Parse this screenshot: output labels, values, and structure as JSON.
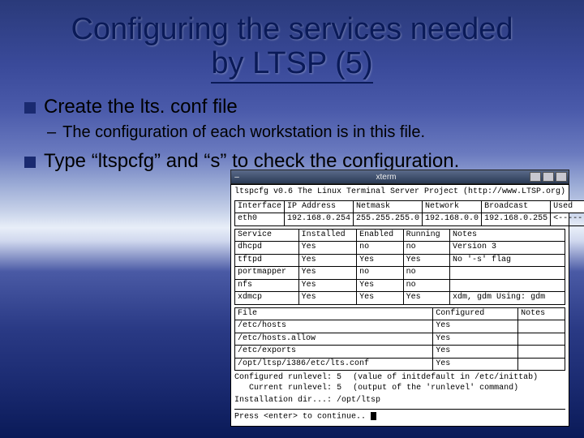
{
  "title_line1": "Configuring the services needed",
  "title_line2": "by LTSP (5)",
  "bullets": {
    "b1": "Create the lts. conf file",
    "b1a": "The configuration of each workstation is in this file.",
    "b2": "Type “ltspcfg” and “s” to check the configuration."
  },
  "terminal": {
    "window_title": "xterm",
    "header_left": "ltspcfg v0.6",
    "header_right": "The Linux Terminal Server Project (http://www.LTSP.org)",
    "iface": {
      "cols": [
        "Interface",
        "IP Address",
        "Netmask",
        "Network",
        "Broadcast",
        "Used"
      ],
      "row": [
        "eth0",
        "192.168.0.254",
        "255.255.255.0",
        "192.168.0.0",
        "192.168.0.255",
        "<-----"
      ]
    },
    "svc": {
      "cols": [
        "Service",
        "Installed",
        "Enabled",
        "Running",
        "Notes"
      ],
      "rows": [
        [
          "dhcpd",
          "Yes",
          "no",
          "no",
          "Version 3"
        ],
        [
          "tftpd",
          "Yes",
          "Yes",
          "Yes",
          "No '-s' flag"
        ],
        [
          "portmapper",
          "Yes",
          "no",
          "no",
          ""
        ],
        [
          "nfs",
          "Yes",
          "Yes",
          "no",
          ""
        ],
        [
          "xdmcp",
          "Yes",
          "Yes",
          "Yes",
          "xdm, gdm   Using: gdm"
        ]
      ]
    },
    "files": {
      "cols": [
        "File",
        "Configured",
        "Notes"
      ],
      "rows": [
        [
          "/etc/hosts",
          "Yes",
          ""
        ],
        [
          "/etc/hosts.allow",
          "Yes",
          ""
        ],
        [
          "/etc/exports",
          "Yes",
          ""
        ],
        [
          "/opt/ltsp/i386/etc/lts.conf",
          "Yes",
          ""
        ]
      ]
    },
    "cfg_runlevel_label": "Configured runlevel:",
    "cfg_runlevel_val": "5",
    "cfg_runlevel_note": "(value of initdefault in /etc/inittab)",
    "cur_runlevel_label": "Current runlevel:",
    "cur_runlevel_val": "5",
    "cur_runlevel_note": "(output of the 'runlevel' command)",
    "install_dir_label": "Installation dir...:",
    "install_dir_val": "/opt/ltsp",
    "prompt": "Press <enter> to continue.."
  }
}
